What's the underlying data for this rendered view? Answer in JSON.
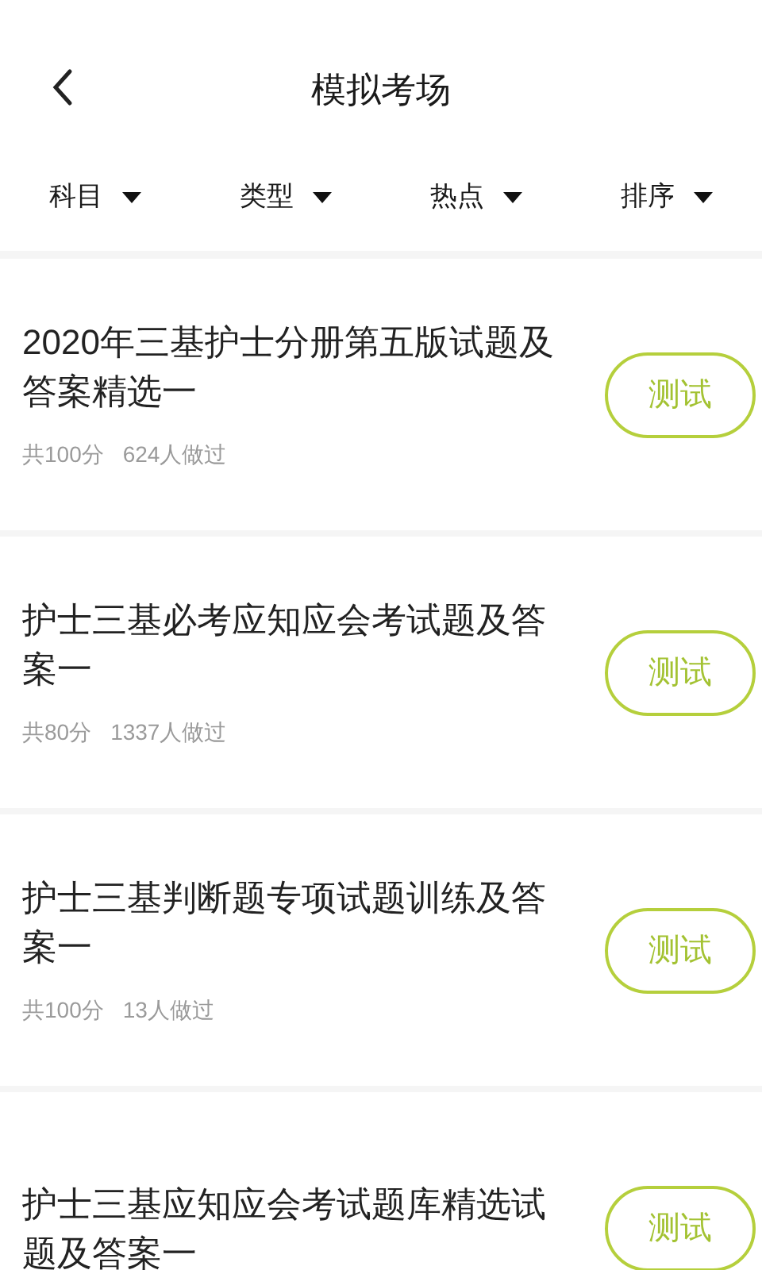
{
  "header": {
    "title": "模拟考场"
  },
  "filters": [
    {
      "label": "科目"
    },
    {
      "label": "类型"
    },
    {
      "label": "热点"
    },
    {
      "label": "排序"
    }
  ],
  "exams": [
    {
      "title": "2020年三基护士分册第五版试题及答案精选一",
      "score": "共100分",
      "takers": "624人做过",
      "button": "测试"
    },
    {
      "title": "护士三基必考应知应会考试题及答案一",
      "score": "共80分",
      "takers": "1337人做过",
      "button": "测试"
    },
    {
      "title": "护士三基判断题专项试题训练及答案一",
      "score": "共100分",
      "takers": "13人做过",
      "button": "测试"
    },
    {
      "title": "护士三基应知应会考试题库精选试题及答案一",
      "button": "测试"
    }
  ]
}
